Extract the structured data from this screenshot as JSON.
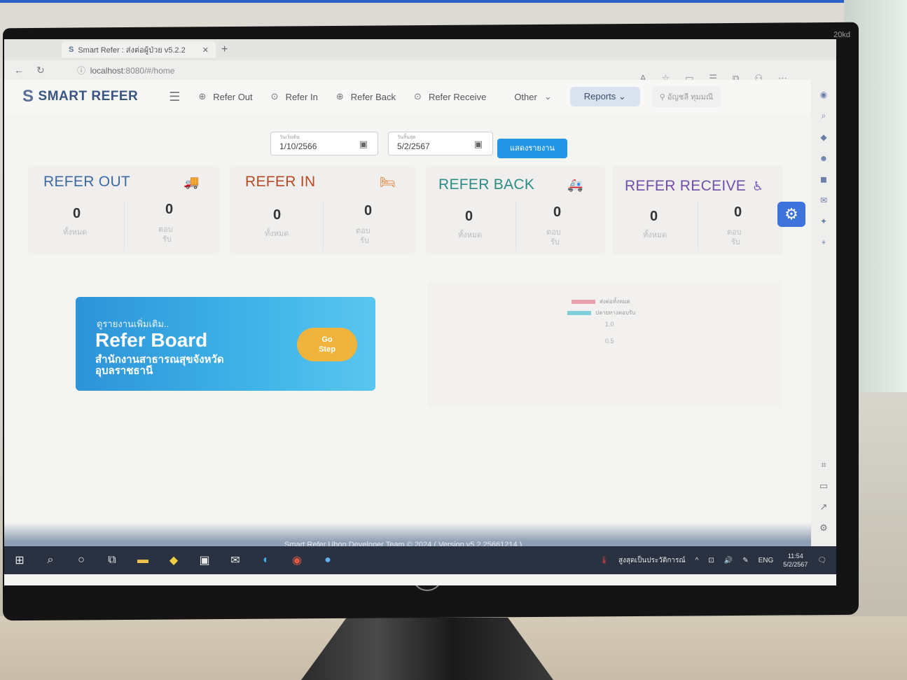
{
  "monitor": {
    "label": "20kd",
    "brand": "hp"
  },
  "browser": {
    "tab_title": "Smart Refer : ส่งต่อผู้ป่วย v5.2.2",
    "url_host": "localhost",
    "url_path": ":8080/#/home"
  },
  "app": {
    "brand": "SMART REFER",
    "nav": {
      "refer_out": "Refer Out",
      "refer_in": "Refer In",
      "refer_back": "Refer Back",
      "refer_receive": "Refer Receive",
      "other": "Other",
      "reports": "Reports",
      "user": "อัญชลี ทุมมณี"
    },
    "filters": {
      "start_label": "วันเริ่มต้น",
      "start_value": "1/10/2566",
      "end_label": "วันสิ้นสุด",
      "end_value": "5/2/2567",
      "show_button": "แสดงรายงาน"
    },
    "cards": [
      {
        "title": "REFER OUT",
        "color": "#3d6aa3",
        "total": "0",
        "total_label": "ทั้งหมด",
        "reply": "0",
        "reply_label_1": "ตอบ",
        "reply_label_2": "รับ"
      },
      {
        "title": "REFER IN",
        "color": "#b64a24",
        "total": "0",
        "total_label": "ทั้งหมด",
        "reply": "0",
        "reply_label_1": "ตอบ",
        "reply_label_2": "รับ"
      },
      {
        "title": "REFER BACK",
        "color": "#2b8c86",
        "total": "0",
        "total_label": "ทั้งหมด",
        "reply": "0",
        "reply_label_1": "ตอบ",
        "reply_label_2": "รับ"
      },
      {
        "title": "REFER RECEIVE",
        "color": "#6f4fa8",
        "total": "0",
        "total_label": "ทั้งหมด",
        "reply": "0",
        "reply_label_1": "ตอบ",
        "reply_label_2": "รับ"
      }
    ],
    "board": {
      "hint": "ดูรายงานเพิ่มเติม..",
      "title": "Refer Board",
      "office": "สำนักงานสาธารณสุขจังหวัดอุบลราชธานี",
      "go_line1": "Go",
      "go_line2": "Step"
    },
    "chart": {
      "legend_sent": "ส่งต่อทั้งหมด",
      "legend_dest": "ปลายทางตอบรับ",
      "sent_color": "#e8a1ad",
      "dest_color": "#7fcfdc",
      "ytick_1": "1.0",
      "ytick_2": "0.5"
    },
    "footer": "Smart Refer Ubon Developer Team © 2024 ( Version v5.2.25661214 )"
  },
  "taskbar": {
    "weather": "สูงสุดเป็นประวัติการณ์",
    "lang": "ENG",
    "time": "11:54",
    "date": "5/2/2567"
  }
}
